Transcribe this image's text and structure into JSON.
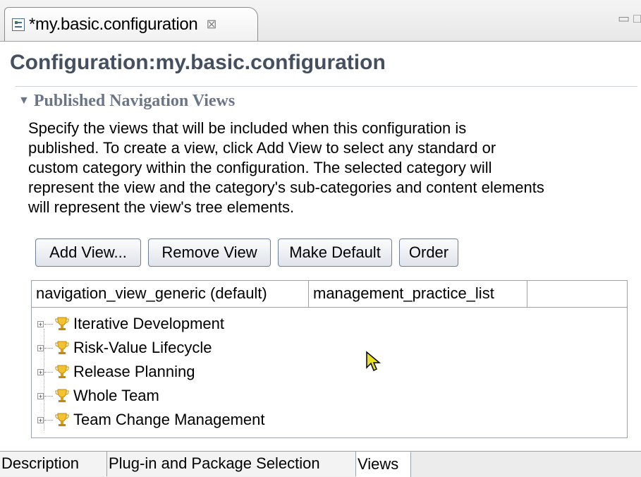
{
  "editor_tab": {
    "title": "*my.basic.configuration",
    "close_glyph": "⊠",
    "icon": "configuration-file-icon"
  },
  "window_controls": {
    "minimize": "▭",
    "maximize": "□"
  },
  "page": {
    "title": "Configuration:my.basic.configuration"
  },
  "section": {
    "twisty": "▼",
    "title": "Published Navigation Views",
    "description_lines": [
      "Specify the views that will be included when this configuration is",
      "published. To create a view, click Add View to select any standard or",
      "custom category within the configuration.  The selected category will",
      "represent the view and the category's sub-categories and content elements",
      "will represent the view's tree elements."
    ]
  },
  "buttons": {
    "add_view": "Add View...",
    "remove_view": "Remove View",
    "make_default": "Make Default",
    "order": "Order"
  },
  "view_tabs": [
    {
      "label": "navigation_view_generic (default)"
    },
    {
      "label": "management_practice_list"
    }
  ],
  "tree": {
    "expander_glyph": "+",
    "item_icon": "trophy-icon",
    "items": [
      {
        "label": "Iterative Development"
      },
      {
        "label": "Risk-Value Lifecycle"
      },
      {
        "label": "Release Planning"
      },
      {
        "label": "Whole Team"
      },
      {
        "label": "Team Change Management"
      }
    ]
  },
  "page_tabs": [
    {
      "label": "Description",
      "active": false
    },
    {
      "label": "Plug-in and Package Selection",
      "active": false
    },
    {
      "label": "Views",
      "active": true
    }
  ],
  "colors": {
    "title_text": "#444f5f",
    "section_text": "#6b7588",
    "trophy": "#e8b020"
  }
}
